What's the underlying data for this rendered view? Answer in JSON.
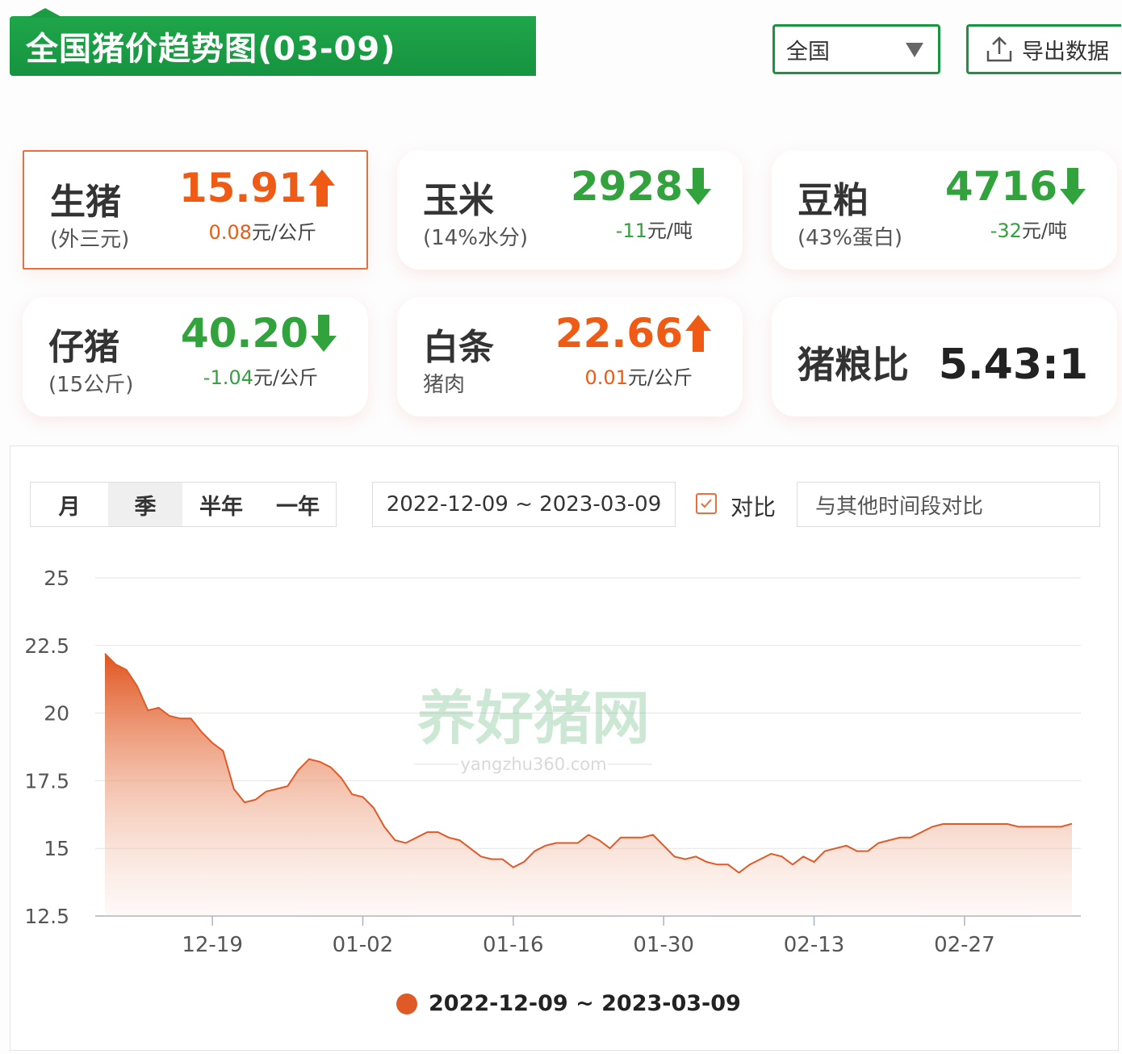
{
  "header": {
    "title": "全国猪价趋势图(03-09)",
    "region": "全国",
    "export_label": "导出数据"
  },
  "cards": [
    {
      "name": "生猪",
      "sub": "(外三元)",
      "value": "15.91",
      "direction": "up",
      "change_num": "0.08",
      "change_unit": "元/公斤"
    },
    {
      "name": "玉米",
      "sub": "(14%水分)",
      "value": "2928",
      "direction": "down",
      "change_num": "-11",
      "change_unit": "元/吨"
    },
    {
      "name": "豆粕",
      "sub": "(43%蛋白)",
      "value": "4716",
      "direction": "down",
      "change_num": "-32",
      "change_unit": "元/吨"
    },
    {
      "name": "仔猪",
      "sub": "(15公斤)",
      "value": "40.20",
      "direction": "down",
      "change_num": "-1.04",
      "change_unit": "元/公斤"
    },
    {
      "name": "白条",
      "sub": "猪肉",
      "value": "22.66",
      "direction": "up",
      "change_num": "0.01",
      "change_unit": "元/公斤"
    }
  ],
  "ratio": {
    "name": "猪粮比",
    "value": "5.43:1"
  },
  "controls": {
    "tabs": [
      "月",
      "季",
      "半年",
      "一年"
    ],
    "selected_tab": "季",
    "date_range": "2022-12-09 ~ 2023-03-09",
    "compare_label": "对比",
    "compare_placeholder": "与其他时间段对比"
  },
  "colors": {
    "brand_green": "#1a9a42",
    "up_orange": "#ef5a14",
    "down_green": "#32a23d",
    "series": "#e05a26"
  },
  "chart_data": {
    "type": "area",
    "x_ticks": [
      "12-19",
      "01-02",
      "01-16",
      "01-30",
      "02-13",
      "02-27"
    ],
    "ylim": [
      12.5,
      25
    ],
    "y_ticks": [
      "12.5",
      "15",
      "17.5",
      "20",
      "22.5",
      "25"
    ],
    "grid": true,
    "legend": "bottom",
    "series": [
      {
        "name": "2022-12-09 ~ 2023-03-09",
        "x": [
          "12-09",
          "12-10",
          "12-11",
          "12-12",
          "12-13",
          "12-14",
          "12-15",
          "12-16",
          "12-17",
          "12-18",
          "12-19",
          "12-20",
          "12-21",
          "12-22",
          "12-23",
          "12-24",
          "12-25",
          "12-26",
          "12-27",
          "12-28",
          "12-29",
          "12-30",
          "12-31",
          "01-01",
          "01-02",
          "01-03",
          "01-04",
          "01-05",
          "01-06",
          "01-07",
          "01-08",
          "01-09",
          "01-10",
          "01-11",
          "01-12",
          "01-13",
          "01-14",
          "01-15",
          "01-16",
          "01-17",
          "01-18",
          "01-19",
          "01-20",
          "01-21",
          "01-22",
          "01-23",
          "01-24",
          "01-25",
          "01-26",
          "01-27",
          "01-28",
          "01-29",
          "01-30",
          "01-31",
          "02-01",
          "02-02",
          "02-03",
          "02-04",
          "02-05",
          "02-06",
          "02-07",
          "02-08",
          "02-09",
          "02-10",
          "02-11",
          "02-12",
          "02-13",
          "02-14",
          "02-15",
          "02-16",
          "02-17",
          "02-18",
          "02-19",
          "02-20",
          "02-21",
          "02-22",
          "02-23",
          "02-24",
          "02-25",
          "02-26",
          "02-27",
          "02-28",
          "03-01",
          "03-02",
          "03-03",
          "03-04",
          "03-05",
          "03-06",
          "03-07",
          "03-08",
          "03-09"
        ],
        "values": [
          22.2,
          21.8,
          21.6,
          21.0,
          20.1,
          20.2,
          19.9,
          19.8,
          19.8,
          19.3,
          18.9,
          18.6,
          17.2,
          16.7,
          16.8,
          17.1,
          17.2,
          17.3,
          17.9,
          18.3,
          18.2,
          18.0,
          17.6,
          17.0,
          16.9,
          16.5,
          15.8,
          15.3,
          15.2,
          15.4,
          15.6,
          15.6,
          15.4,
          15.3,
          15.0,
          14.7,
          14.6,
          14.6,
          14.3,
          14.5,
          14.9,
          15.1,
          15.2,
          15.2,
          15.2,
          15.5,
          15.3,
          15.0,
          15.4,
          15.4,
          15.4,
          15.5,
          15.1,
          14.7,
          14.6,
          14.7,
          14.5,
          14.4,
          14.4,
          14.1,
          14.4,
          14.6,
          14.8,
          14.7,
          14.4,
          14.7,
          14.5,
          14.9,
          15.0,
          15.1,
          14.9,
          14.9,
          15.2,
          15.3,
          15.4,
          15.4,
          15.6,
          15.8,
          15.9,
          15.9,
          15.9,
          15.9,
          15.9,
          15.9,
          15.9,
          15.8,
          15.8,
          15.8,
          15.8,
          15.8,
          15.91
        ]
      }
    ]
  },
  "watermark": {
    "brand": "养好猪网",
    "url": "yangzhu360.com"
  }
}
